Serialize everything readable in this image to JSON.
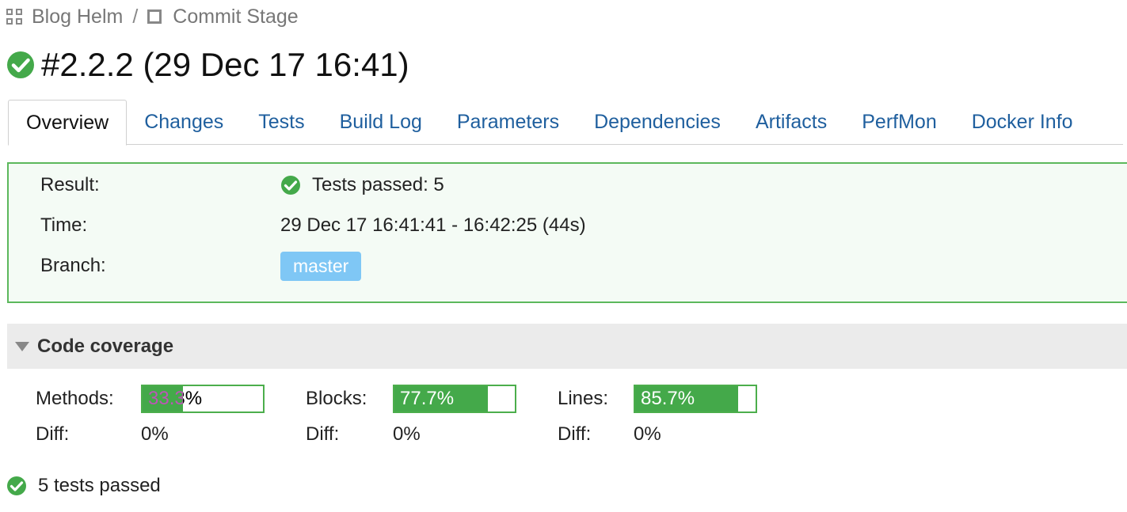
{
  "breadcrumb": {
    "project": "Blog Helm",
    "separator": "/",
    "build_config": "Commit Stage"
  },
  "build": {
    "title": "#2.2.2 (29 Dec 17 16:41)",
    "status": "success"
  },
  "tabs": [
    {
      "label": "Overview",
      "active": true
    },
    {
      "label": "Changes",
      "active": false
    },
    {
      "label": "Tests",
      "active": false
    },
    {
      "label": "Build Log",
      "active": false
    },
    {
      "label": "Parameters",
      "active": false
    },
    {
      "label": "Dependencies",
      "active": false
    },
    {
      "label": "Artifacts",
      "active": false
    },
    {
      "label": "PerfMon",
      "active": false
    },
    {
      "label": "Docker Info",
      "active": false
    }
  ],
  "summary": {
    "result_label": "Result:",
    "result_value": "Tests passed: 5",
    "time_label": "Time:",
    "time_value": "29 Dec 17 16:41:41 - 16:42:25 (44s)",
    "branch_label": "Branch:",
    "branch_value": "master"
  },
  "coverage": {
    "header": "Code coverage",
    "metrics": [
      {
        "label": "Methods:",
        "value": "33.3%",
        "percent": 33.3,
        "diff_label": "Diff:",
        "diff": "0%"
      },
      {
        "label": "Blocks:",
        "value": "77.7%",
        "percent": 77.7,
        "diff_label": "Diff:",
        "diff": "0%"
      },
      {
        "label": "Lines:",
        "value": "85.7%",
        "percent": 85.7,
        "diff_label": "Diff:",
        "diff": "0%"
      }
    ]
  },
  "tests_summary": "5 tests passed",
  "colors": {
    "success": "#44a94a",
    "link": "#1f5f9e",
    "branch_badge": "#7fc7f5",
    "summary_border": "#5cb85c"
  },
  "icons": {
    "project": "grid-icon",
    "build_config": "square-icon",
    "status": "check-circle-icon",
    "collapse": "triangle-down-icon"
  }
}
